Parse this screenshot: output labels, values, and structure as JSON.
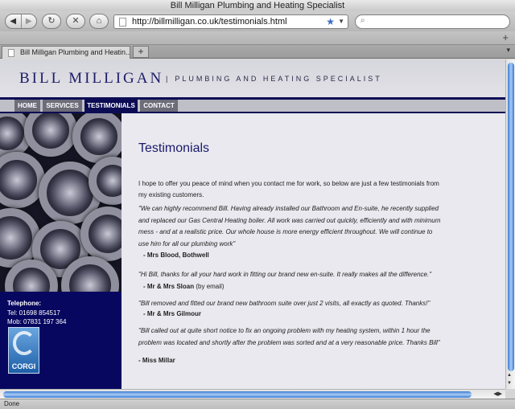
{
  "window": {
    "title": "Bill Milligan Plumbing and Heating Specialist"
  },
  "toolbar": {
    "back_icon": "back-arrow-icon",
    "forward_icon": "forward-arrow-icon",
    "reload_glyph": "↻",
    "stop_glyph": "✕",
    "home_glyph": "⌂",
    "url": "http://billmilligan.co.uk/testimonials.html",
    "bookmark_star": "★",
    "url_dropdown": "▼",
    "search_glyph": "⌕",
    "search_placeholder": ""
  },
  "bookmarks_bar": {
    "add_glyph": "+"
  },
  "tabs": {
    "active_tab_label": "Bill Milligan Plumbing and Heatin...",
    "new_tab_glyph": "+",
    "tab_menu_glyph": "▾"
  },
  "site": {
    "logo": "BILL MILLIGAN",
    "tagline_sep": "|",
    "tagline": "PLUMBING AND HEATING SPECIALIST",
    "nav": [
      "HOME",
      "SERVICES",
      "TESTIMONIALS",
      "CONTACT"
    ],
    "active_nav": "TESTIMONIALS",
    "contact": {
      "label": "Telephone:",
      "tel": "Tel: 01698 854517",
      "mob": "Mob: 07831 197 364"
    },
    "badge_label": "CORGI"
  },
  "content": {
    "heading": "Testimonials",
    "intro": "I hope to offer you peace of mind when you contact me for work, so below are just a few testimonials from my existing customers.",
    "testimonials": [
      {
        "quote": "\"We can highly recommend Bill. Having already installed our Bathroom and En-suite, he recently supplied and replaced our Gas Central Heating boiler. All work was carried out quickly, efficiently and with minimum mess - and at a realistic price. Our whole house is more energy efficient throughout. We will continue to use him for all our plumbing work\"",
        "author": "- Mrs Blood, Bothwell",
        "note": ""
      },
      {
        "quote": "\"Hi Bill, thanks for all your hard work in fitting our brand new en-suite. It really makes all the difference.\"",
        "author": "- Mr & Mrs Sloan",
        "note": "(by email)"
      },
      {
        "quote": "\"Bill removed and fitted our brand new bathroom suite over just 2 visits, all exactly as quoted. Thanks!\"",
        "author": "- Mr & Mrs Gilmour",
        "note": ""
      },
      {
        "quote": "\"Bill called out at quite short notice to fix an ongoing problem with my heating system, within 1 hour the problem was located and shortly after the problem was sorted and at a very reasonable price.  Thanks Bill\"",
        "author": "- Miss Millar",
        "note": ""
      }
    ]
  },
  "scrollbars": {
    "up_arrow": "▲",
    "down_arrow": "▼",
    "left_arrow": "◀",
    "right_arrow": "▶"
  },
  "status": {
    "text": "Done"
  }
}
